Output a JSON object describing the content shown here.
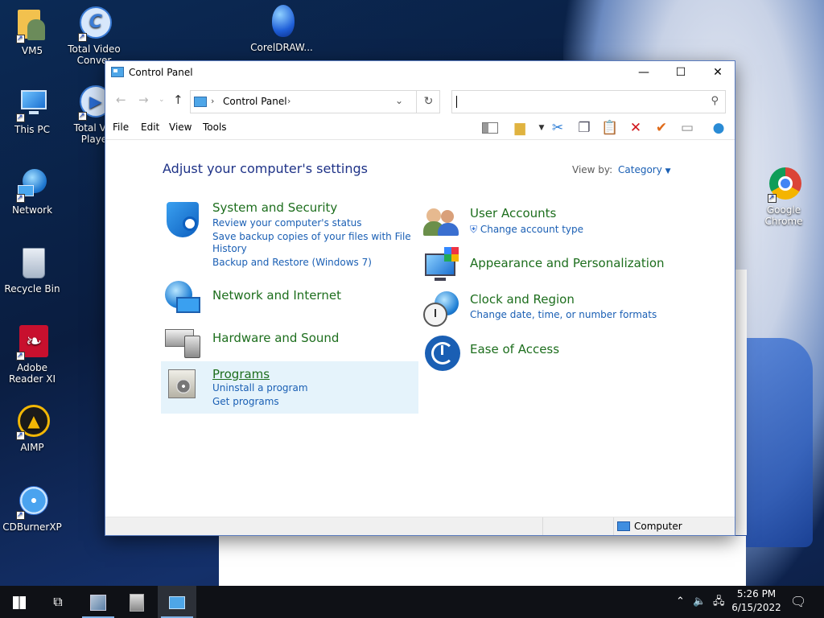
{
  "desktop": {
    "icons": [
      {
        "label": "VM5"
      },
      {
        "label": "Total Video Conver"
      },
      {
        "label": "CorelDRAW..."
      },
      {
        "label": "This PC"
      },
      {
        "label": "Total Vid Playe"
      },
      {
        "label": "Network"
      },
      {
        "label": "Recycle Bin"
      },
      {
        "label": "Adobe Reader XI"
      },
      {
        "label": "AIMP"
      },
      {
        "label": "CDBurnerXP"
      },
      {
        "label": "Google Chrome"
      }
    ]
  },
  "window": {
    "title": "Control Panel",
    "controls": {
      "minimize": "—",
      "maximize": "☐",
      "close": "✕"
    },
    "address": {
      "crumb": "Control Panel"
    },
    "menus": [
      "File",
      "Edit",
      "View",
      "Tools"
    ],
    "heading": "Adjust your computer's settings",
    "view_by_label": "View by:",
    "view_by_value": "Category",
    "categories": [
      {
        "title": "System and Security",
        "links": [
          "Review your computer's status",
          "Save backup copies of your files with File",
          "History",
          "Backup and Restore (Windows 7)"
        ]
      },
      {
        "title": "Network and Internet",
        "links": []
      },
      {
        "title": "Hardware and Sound",
        "links": []
      },
      {
        "title": "Programs",
        "links": [
          "Uninstall a program",
          "Get programs"
        ]
      },
      {
        "title": "User Accounts",
        "links": [
          "Change account type"
        ]
      },
      {
        "title": "Appearance and Personalization",
        "links": []
      },
      {
        "title": "Clock and Region",
        "links": [
          "Change date, time, or number formats"
        ]
      },
      {
        "title": "Ease of Access",
        "links": []
      }
    ],
    "status": {
      "location": "Computer"
    }
  },
  "taskbar": {
    "clock_time": "5:26 PM",
    "clock_date": "6/15/2022"
  }
}
